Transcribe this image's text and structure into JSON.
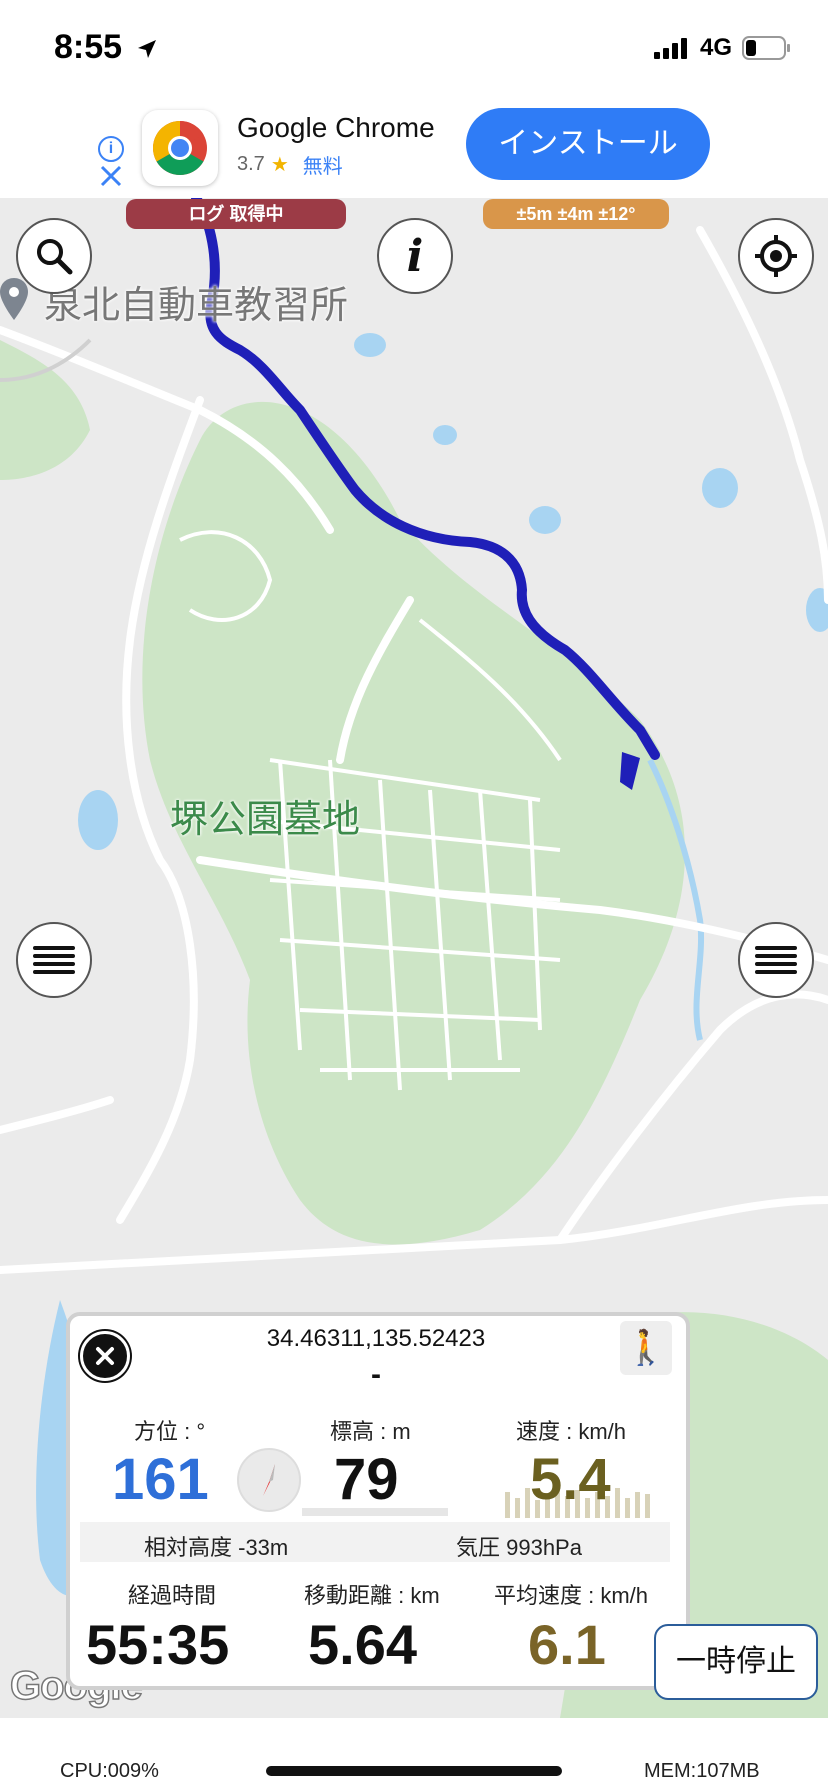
{
  "status_bar": {
    "time": "8:55",
    "network": "4G",
    "icons": [
      "location-arrow-icon",
      "signal-icon",
      "battery-icon"
    ]
  },
  "ad": {
    "app_name": "Google Chrome",
    "rating": "3.7",
    "price": "無料",
    "install_label": "インストール",
    "icons": [
      "info-icon",
      "close-icon",
      "chrome-icon",
      "star-icon"
    ]
  },
  "map": {
    "log_status": "ログ 取得中",
    "accuracy": "±5m ±4m ±12°",
    "place_school": "泉北自動車教習所",
    "place_park": "堺公園墓地",
    "logo": "Google",
    "colors": {
      "track": "#1f1fb8",
      "park": "#cde5c6",
      "water": "#a8d4f2",
      "road": "#ffffff"
    }
  },
  "panel": {
    "coordinates": "34.46311,135.52423",
    "address": "-",
    "heading": {
      "label": "方位 : °",
      "value": "161"
    },
    "altitude": {
      "label": "標高 : m",
      "value": "79"
    },
    "speed": {
      "label": "速度 : km/h",
      "value": "5.4"
    },
    "relative_altitude": "相対高度 -33m",
    "pressure": "気圧 993hPa",
    "elapsed": {
      "label": "経過時間",
      "value": "55:35"
    },
    "distance": {
      "label": "移動距離 : km",
      "value": "5.64"
    },
    "avg_speed": {
      "label": "平均速度 : km/h",
      "value": "6.1"
    },
    "colors": {
      "heading": "#2e6fd8",
      "speed": "#6b6020",
      "avg_speed": "#7a6428"
    }
  },
  "controls": {
    "pause_label": "一時停止"
  },
  "bottom": {
    "cpu": "CPU:009%",
    "mem": "MEM:107MB"
  }
}
